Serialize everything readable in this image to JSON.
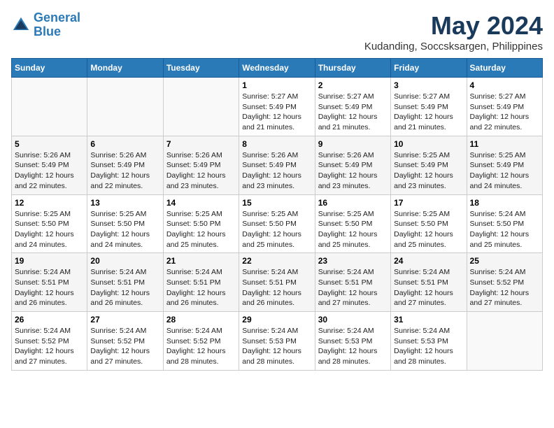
{
  "logo": {
    "line1": "General",
    "line2": "Blue"
  },
  "title": "May 2024",
  "location": "Kudanding, Soccsksargen, Philippines",
  "weekdays": [
    "Sunday",
    "Monday",
    "Tuesday",
    "Wednesday",
    "Thursday",
    "Friday",
    "Saturday"
  ],
  "weeks": [
    [
      {
        "day": "",
        "sunrise": "",
        "sunset": "",
        "daylight": ""
      },
      {
        "day": "",
        "sunrise": "",
        "sunset": "",
        "daylight": ""
      },
      {
        "day": "",
        "sunrise": "",
        "sunset": "",
        "daylight": ""
      },
      {
        "day": "1",
        "sunrise": "5:27 AM",
        "sunset": "5:49 PM",
        "daylight": "12 hours and 21 minutes."
      },
      {
        "day": "2",
        "sunrise": "5:27 AM",
        "sunset": "5:49 PM",
        "daylight": "12 hours and 21 minutes."
      },
      {
        "day": "3",
        "sunrise": "5:27 AM",
        "sunset": "5:49 PM",
        "daylight": "12 hours and 21 minutes."
      },
      {
        "day": "4",
        "sunrise": "5:27 AM",
        "sunset": "5:49 PM",
        "daylight": "12 hours and 22 minutes."
      }
    ],
    [
      {
        "day": "5",
        "sunrise": "5:26 AM",
        "sunset": "5:49 PM",
        "daylight": "12 hours and 22 minutes."
      },
      {
        "day": "6",
        "sunrise": "5:26 AM",
        "sunset": "5:49 PM",
        "daylight": "12 hours and 22 minutes."
      },
      {
        "day": "7",
        "sunrise": "5:26 AM",
        "sunset": "5:49 PM",
        "daylight": "12 hours and 23 minutes."
      },
      {
        "day": "8",
        "sunrise": "5:26 AM",
        "sunset": "5:49 PM",
        "daylight": "12 hours and 23 minutes."
      },
      {
        "day": "9",
        "sunrise": "5:26 AM",
        "sunset": "5:49 PM",
        "daylight": "12 hours and 23 minutes."
      },
      {
        "day": "10",
        "sunrise": "5:25 AM",
        "sunset": "5:49 PM",
        "daylight": "12 hours and 23 minutes."
      },
      {
        "day": "11",
        "sunrise": "5:25 AM",
        "sunset": "5:49 PM",
        "daylight": "12 hours and 24 minutes."
      }
    ],
    [
      {
        "day": "12",
        "sunrise": "5:25 AM",
        "sunset": "5:50 PM",
        "daylight": "12 hours and 24 minutes."
      },
      {
        "day": "13",
        "sunrise": "5:25 AM",
        "sunset": "5:50 PM",
        "daylight": "12 hours and 24 minutes."
      },
      {
        "day": "14",
        "sunrise": "5:25 AM",
        "sunset": "5:50 PM",
        "daylight": "12 hours and 25 minutes."
      },
      {
        "day": "15",
        "sunrise": "5:25 AM",
        "sunset": "5:50 PM",
        "daylight": "12 hours and 25 minutes."
      },
      {
        "day": "16",
        "sunrise": "5:25 AM",
        "sunset": "5:50 PM",
        "daylight": "12 hours and 25 minutes."
      },
      {
        "day": "17",
        "sunrise": "5:25 AM",
        "sunset": "5:50 PM",
        "daylight": "12 hours and 25 minutes."
      },
      {
        "day": "18",
        "sunrise": "5:24 AM",
        "sunset": "5:50 PM",
        "daylight": "12 hours and 25 minutes."
      }
    ],
    [
      {
        "day": "19",
        "sunrise": "5:24 AM",
        "sunset": "5:51 PM",
        "daylight": "12 hours and 26 minutes."
      },
      {
        "day": "20",
        "sunrise": "5:24 AM",
        "sunset": "5:51 PM",
        "daylight": "12 hours and 26 minutes."
      },
      {
        "day": "21",
        "sunrise": "5:24 AM",
        "sunset": "5:51 PM",
        "daylight": "12 hours and 26 minutes."
      },
      {
        "day": "22",
        "sunrise": "5:24 AM",
        "sunset": "5:51 PM",
        "daylight": "12 hours and 26 minutes."
      },
      {
        "day": "23",
        "sunrise": "5:24 AM",
        "sunset": "5:51 PM",
        "daylight": "12 hours and 27 minutes."
      },
      {
        "day": "24",
        "sunrise": "5:24 AM",
        "sunset": "5:51 PM",
        "daylight": "12 hours and 27 minutes."
      },
      {
        "day": "25",
        "sunrise": "5:24 AM",
        "sunset": "5:52 PM",
        "daylight": "12 hours and 27 minutes."
      }
    ],
    [
      {
        "day": "26",
        "sunrise": "5:24 AM",
        "sunset": "5:52 PM",
        "daylight": "12 hours and 27 minutes."
      },
      {
        "day": "27",
        "sunrise": "5:24 AM",
        "sunset": "5:52 PM",
        "daylight": "12 hours and 27 minutes."
      },
      {
        "day": "28",
        "sunrise": "5:24 AM",
        "sunset": "5:52 PM",
        "daylight": "12 hours and 28 minutes."
      },
      {
        "day": "29",
        "sunrise": "5:24 AM",
        "sunset": "5:53 PM",
        "daylight": "12 hours and 28 minutes."
      },
      {
        "day": "30",
        "sunrise": "5:24 AM",
        "sunset": "5:53 PM",
        "daylight": "12 hours and 28 minutes."
      },
      {
        "day": "31",
        "sunrise": "5:24 AM",
        "sunset": "5:53 PM",
        "daylight": "12 hours and 28 minutes."
      },
      {
        "day": "",
        "sunrise": "",
        "sunset": "",
        "daylight": ""
      }
    ]
  ],
  "labels": {
    "sunrise": "Sunrise:",
    "sunset": "Sunset:",
    "daylight": "Daylight:"
  }
}
